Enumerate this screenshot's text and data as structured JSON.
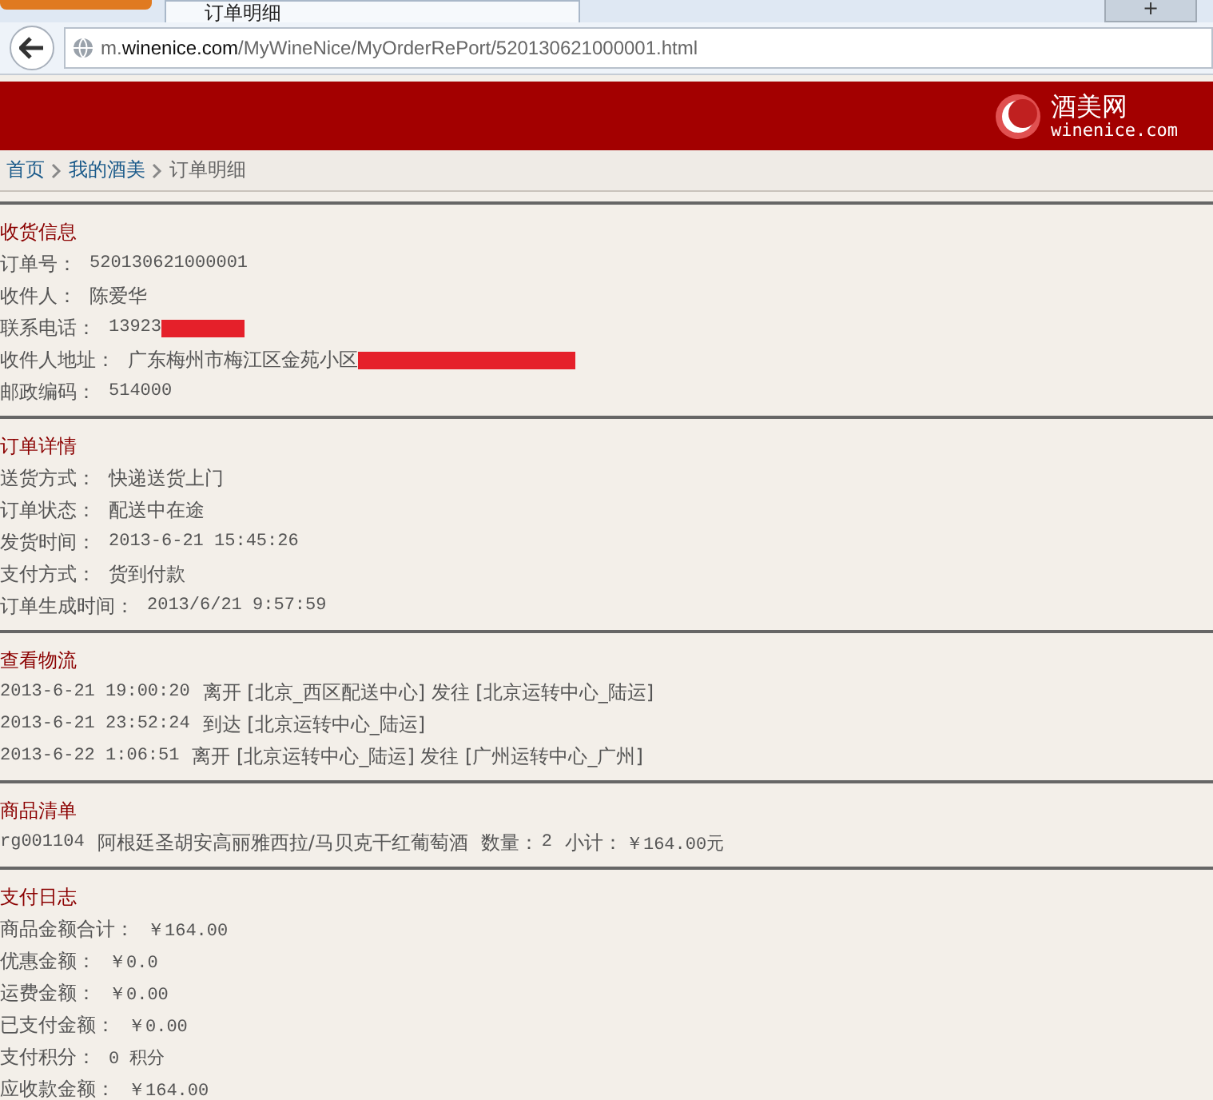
{
  "browser": {
    "tab_title": "订单明细",
    "new_tab": "+",
    "url": "m.**winenice.com**/MyWineNice/MyOrderRePort/520130621000001.html"
  },
  "header": {
    "logo_name": "酒美网",
    "logo_domain": "winenice.com"
  },
  "breadcrumb": [
    {
      "label": "首页",
      "link": true
    },
    {
      "label": "我的酒美",
      "link": true
    },
    {
      "label": "订单明细",
      "link": false
    }
  ],
  "sections": [
    {
      "title": "收货信息",
      "kind": "fields",
      "rows": [
        {
          "label": "订单号：",
          "value": "520130621000001",
          "mono": true,
          "redacted": false
        },
        {
          "label": "收件人：",
          "value": "陈爱华",
          "mono": false,
          "redacted": false
        },
        {
          "label": "联系电话：",
          "value": "13923",
          "mono": true,
          "redacted": true
        },
        {
          "label": "收件人地址：",
          "value": "广东梅州市梅江区金苑小区",
          "mono": false,
          "redacted": true
        },
        {
          "label": "邮政编码：",
          "value": "514000",
          "mono": true,
          "redacted": false
        }
      ]
    },
    {
      "title": "订单详情",
      "kind": "fields",
      "rows": [
        {
          "label": "送货方式：",
          "value": "快递送货上门",
          "mono": false,
          "redacted": false
        },
        {
          "label": "订单状态：",
          "value": "配送中在途",
          "mono": false,
          "redacted": false
        },
        {
          "label": "发货时间：",
          "value": "2013-6-21 15:45:26",
          "mono": true,
          "redacted": false
        },
        {
          "label": "支付方式：",
          "value": "货到付款",
          "mono": false,
          "redacted": false
        },
        {
          "label": "订单生成时间：",
          "value": "2013/6/21 9:57:59",
          "mono": true,
          "redacted": false
        }
      ]
    },
    {
      "title": "查看物流",
      "kind": "log",
      "rows": [
        {
          "time": "2013-6-21 19:00:20",
          "text": "离开 [北京_西区配送中心] 发往 [北京运转中心_陆运]"
        },
        {
          "time": "2013-6-21 23:52:24",
          "text": "到达 [北京运转中心_陆运]"
        },
        {
          "time": "2013-6-22 1:06:51",
          "text": "离开 [北京运转中心_陆运] 发往 [广州运转中心_广州]"
        }
      ]
    },
    {
      "title": "商品清单",
      "kind": "items",
      "rows": [
        {
          "code": "rg001104",
          "name": "阿根廷圣胡安高丽雅西拉/马贝克干红葡萄酒",
          "qty_label": "数量：",
          "qty": "2",
          "subtotal_label": "小计：",
          "subtotal": "￥164.00元"
        }
      ]
    },
    {
      "title": "支付日志",
      "kind": "fields",
      "rows": [
        {
          "label": "商品金额合计：",
          "value": "￥164.00",
          "mono": true,
          "redacted": false
        },
        {
          "label": "优惠金额：",
          "value": "￥0.0",
          "mono": true,
          "redacted": false
        },
        {
          "label": "运费金额：",
          "value": "￥0.00",
          "mono": true,
          "redacted": false
        },
        {
          "label": "已支付金额：",
          "value": "￥0.00",
          "mono": true,
          "redacted": false
        },
        {
          "label": "支付积分：",
          "value": "0 积分",
          "mono": true,
          "redacted": false
        },
        {
          "label": "应收款金额：",
          "value": "￥164.00",
          "mono": true,
          "redacted": false
        }
      ]
    }
  ]
}
